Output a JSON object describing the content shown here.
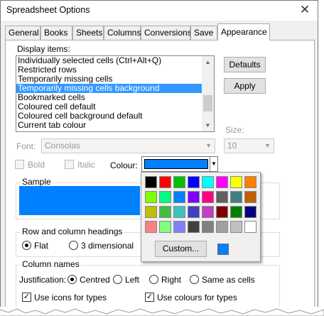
{
  "window": {
    "title": "Spreadsheet Options"
  },
  "tabs": [
    {
      "label": "General"
    },
    {
      "label": "Books"
    },
    {
      "label": "Sheets"
    },
    {
      "label": "Columns"
    },
    {
      "label": "Conversions"
    },
    {
      "label": "Save"
    },
    {
      "label": "Appearance"
    }
  ],
  "display_items": {
    "label": "Display items:",
    "items": [
      "Individually selected cells (Ctrl+Alt+Q)",
      "Restricted rows",
      "Temporarily missing cells",
      "Temporarily missing cells background",
      "Bookmarked cells",
      "Coloured cell default",
      "Coloured cell background default",
      "Current tab colour"
    ],
    "selected": "Temporarily missing cells background"
  },
  "buttons": {
    "defaults": "Defaults",
    "apply": "Apply",
    "custom": "Custom..."
  },
  "font": {
    "label": "Font:",
    "value": "Consolas"
  },
  "size": {
    "label": "Size:",
    "value": "10"
  },
  "style": {
    "bold": "Bold",
    "italic": "Italic"
  },
  "colour": {
    "label": "Colour:",
    "value": "#0080ff"
  },
  "sample": {
    "label": "Sample"
  },
  "headings": {
    "title": "Row and column headings",
    "flat": "Flat",
    "three_d": "3 dimensional"
  },
  "column_names": {
    "title": "Column names",
    "justification_label": "Justification:",
    "centred": "Centred",
    "left": "Left",
    "right": "Right",
    "same_as_cells": "Same as cells",
    "use_icons": "Use icons for types",
    "use_colours": "Use colours for types"
  },
  "palette": [
    [
      "#000000",
      "#ff0000",
      "#00c000",
      "#0000ff",
      "#00ffff",
      "#ff00ff",
      "#ffff00",
      "#ff8000"
    ],
    [
      "#80ff00",
      "#00ff80",
      "#0080ff",
      "#8000ff",
      "#ff0080",
      "#606060",
      "#408080",
      "#c06000"
    ],
    [
      "#c0c000",
      "#40c040",
      "#40c0c0",
      "#4040c0",
      "#c040c0",
      "#800000",
      "#008000",
      "#000080"
    ],
    [
      "#ff8080",
      "#80ff80",
      "#8080ff",
      "#404040",
      "#808080",
      "#a0a0a0",
      "#c0c0c0",
      "#ffffff"
    ]
  ],
  "icons": {
    "close": "close-icon",
    "dropdown": "chevron-down-icon",
    "scroll_up": "scroll-up-icon",
    "scroll_down": "scroll-down-icon",
    "check": "checkmark-icon"
  }
}
